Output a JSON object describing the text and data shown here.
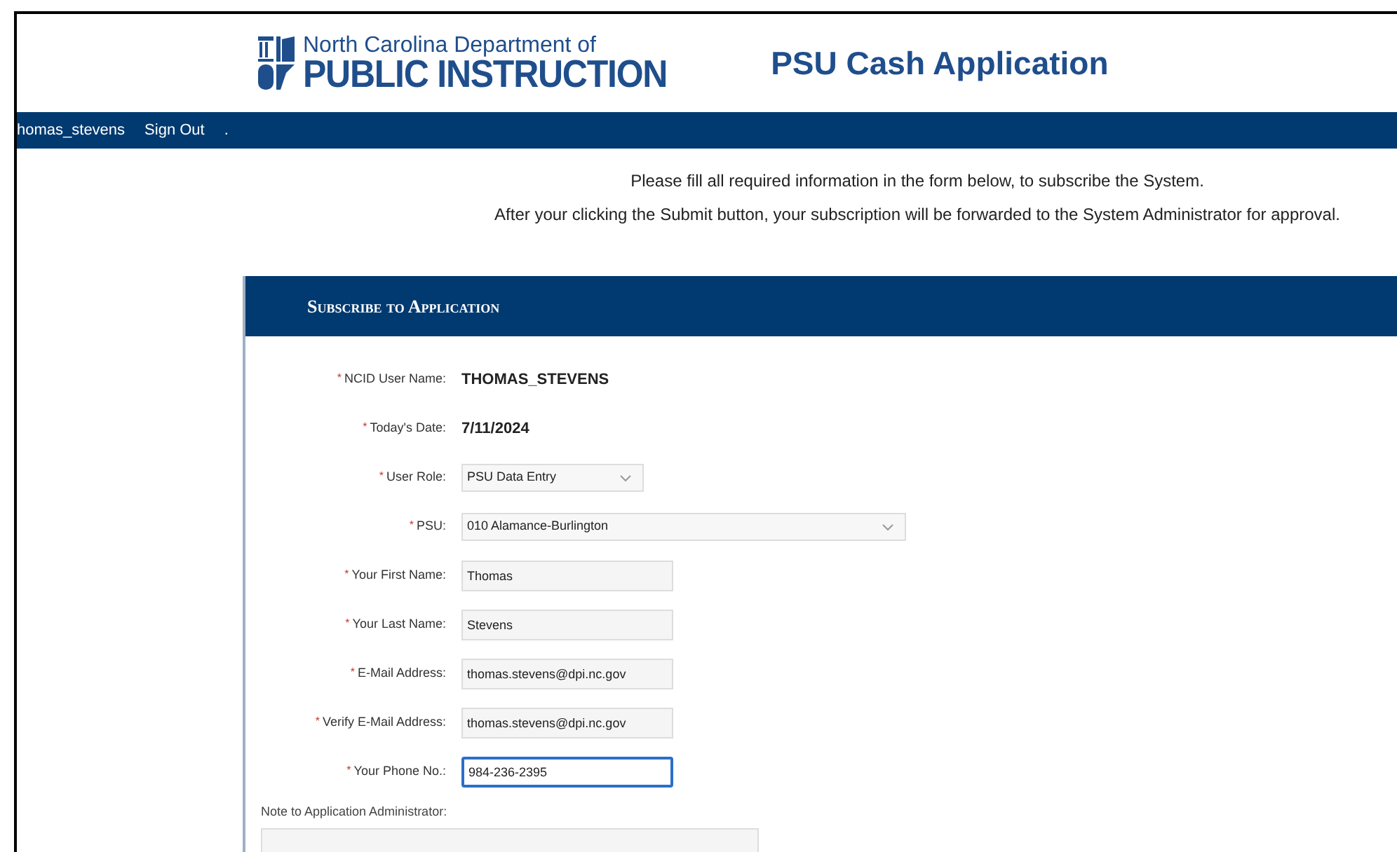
{
  "header": {
    "logo_line_1": "North Carolina Department of",
    "logo_line_2": "PUBLIC INSTRUCTION",
    "app_title": "PSU Cash Application"
  },
  "nav": {
    "items": [
      {
        "label": "homas_stevens"
      },
      {
        "label": "Sign Out"
      },
      {
        "label": "."
      }
    ]
  },
  "intro": [
    "Please fill all required information in the form below, to subscribe the System.",
    "After your clicking the Submit button, your subscription will be forwarded to the System Administrator for approval."
  ],
  "panel": {
    "title": "Subscribe to Application",
    "fields": [
      {
        "kind": "static",
        "required_mark": "*",
        "label": "NCID User Name:",
        "value": "THOMAS_STEVENS"
      },
      {
        "kind": "static",
        "required_mark": "*",
        "label": "Today's Date:",
        "value": "7/11/2024"
      },
      {
        "kind": "select",
        "required_mark": "*",
        "label": "User Role:",
        "value": "PSU Data Entry"
      },
      {
        "kind": "wide_select",
        "required_mark": "*",
        "label": "PSU:",
        "value": "010 Alamance-Burlington"
      },
      {
        "kind": "input",
        "required_mark": "*",
        "label": "Your First Name:",
        "value": "Thomas",
        "focused": false
      },
      {
        "kind": "input",
        "required_mark": "*",
        "label": "Your Last Name:",
        "value": "Stevens",
        "focused": false
      },
      {
        "kind": "input",
        "required_mark": "*",
        "label": "E-Mail Address:",
        "value": "thomas.stevens@dpi.nc.gov",
        "focused": false
      },
      {
        "kind": "input",
        "required_mark": "*",
        "label": "Verify E-Mail Address:",
        "value": "thomas.stevens@dpi.nc.gov",
        "focused": false
      },
      {
        "kind": "input",
        "required_mark": "*",
        "label": "Your Phone No.:",
        "value": "984-236-2395",
        "focused": true
      }
    ],
    "note_label": "Note to Application Administrator:"
  }
}
